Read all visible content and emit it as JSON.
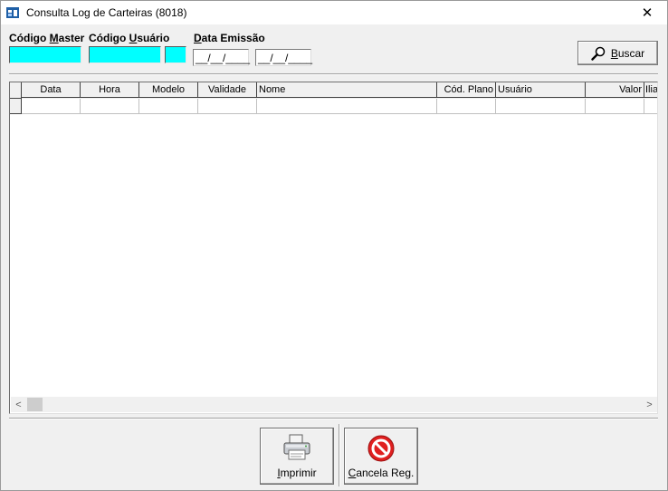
{
  "window": {
    "title": "Consulta Log de Carteiras (8018)",
    "close_glyph": "✕"
  },
  "filters": {
    "codigo_master_label_prefix": "Código ",
    "codigo_master_label_mnemonic": "M",
    "codigo_master_label_suffix": "aster",
    "codigo_usuario_label_prefix": "Código ",
    "codigo_usuario_label_mnemonic": "U",
    "codigo_usuario_label_suffix": "suário",
    "data_emissao_label_mnemonic": "D",
    "data_emissao_label_suffix": "ata Emissão",
    "date_from_value": "__/__/____",
    "date_to_value": "__/__/____",
    "buscar_label_mnemonic": "B",
    "buscar_label_suffix": "uscar"
  },
  "grid": {
    "columns": [
      "Data",
      "Hora",
      "Modelo",
      "Validade",
      "Nome",
      "Cód. Plano",
      "Usuário",
      "Valor",
      "Ilia"
    ]
  },
  "scrollbar": {
    "left_arrow": "<",
    "right_arrow": ">"
  },
  "actions": {
    "imprimir_mnemonic": "I",
    "imprimir_suffix": "mprimir",
    "cancela_mnemonic": "C",
    "cancela_suffix": "ancela Reg."
  },
  "colors": {
    "input_cyan": "#00ffff",
    "cancel_red": "#e02020"
  },
  "icons": {
    "app": "app-window-icon",
    "search": "magnifier-icon",
    "print": "printer-icon",
    "cancel": "cancel-circle-icon"
  }
}
